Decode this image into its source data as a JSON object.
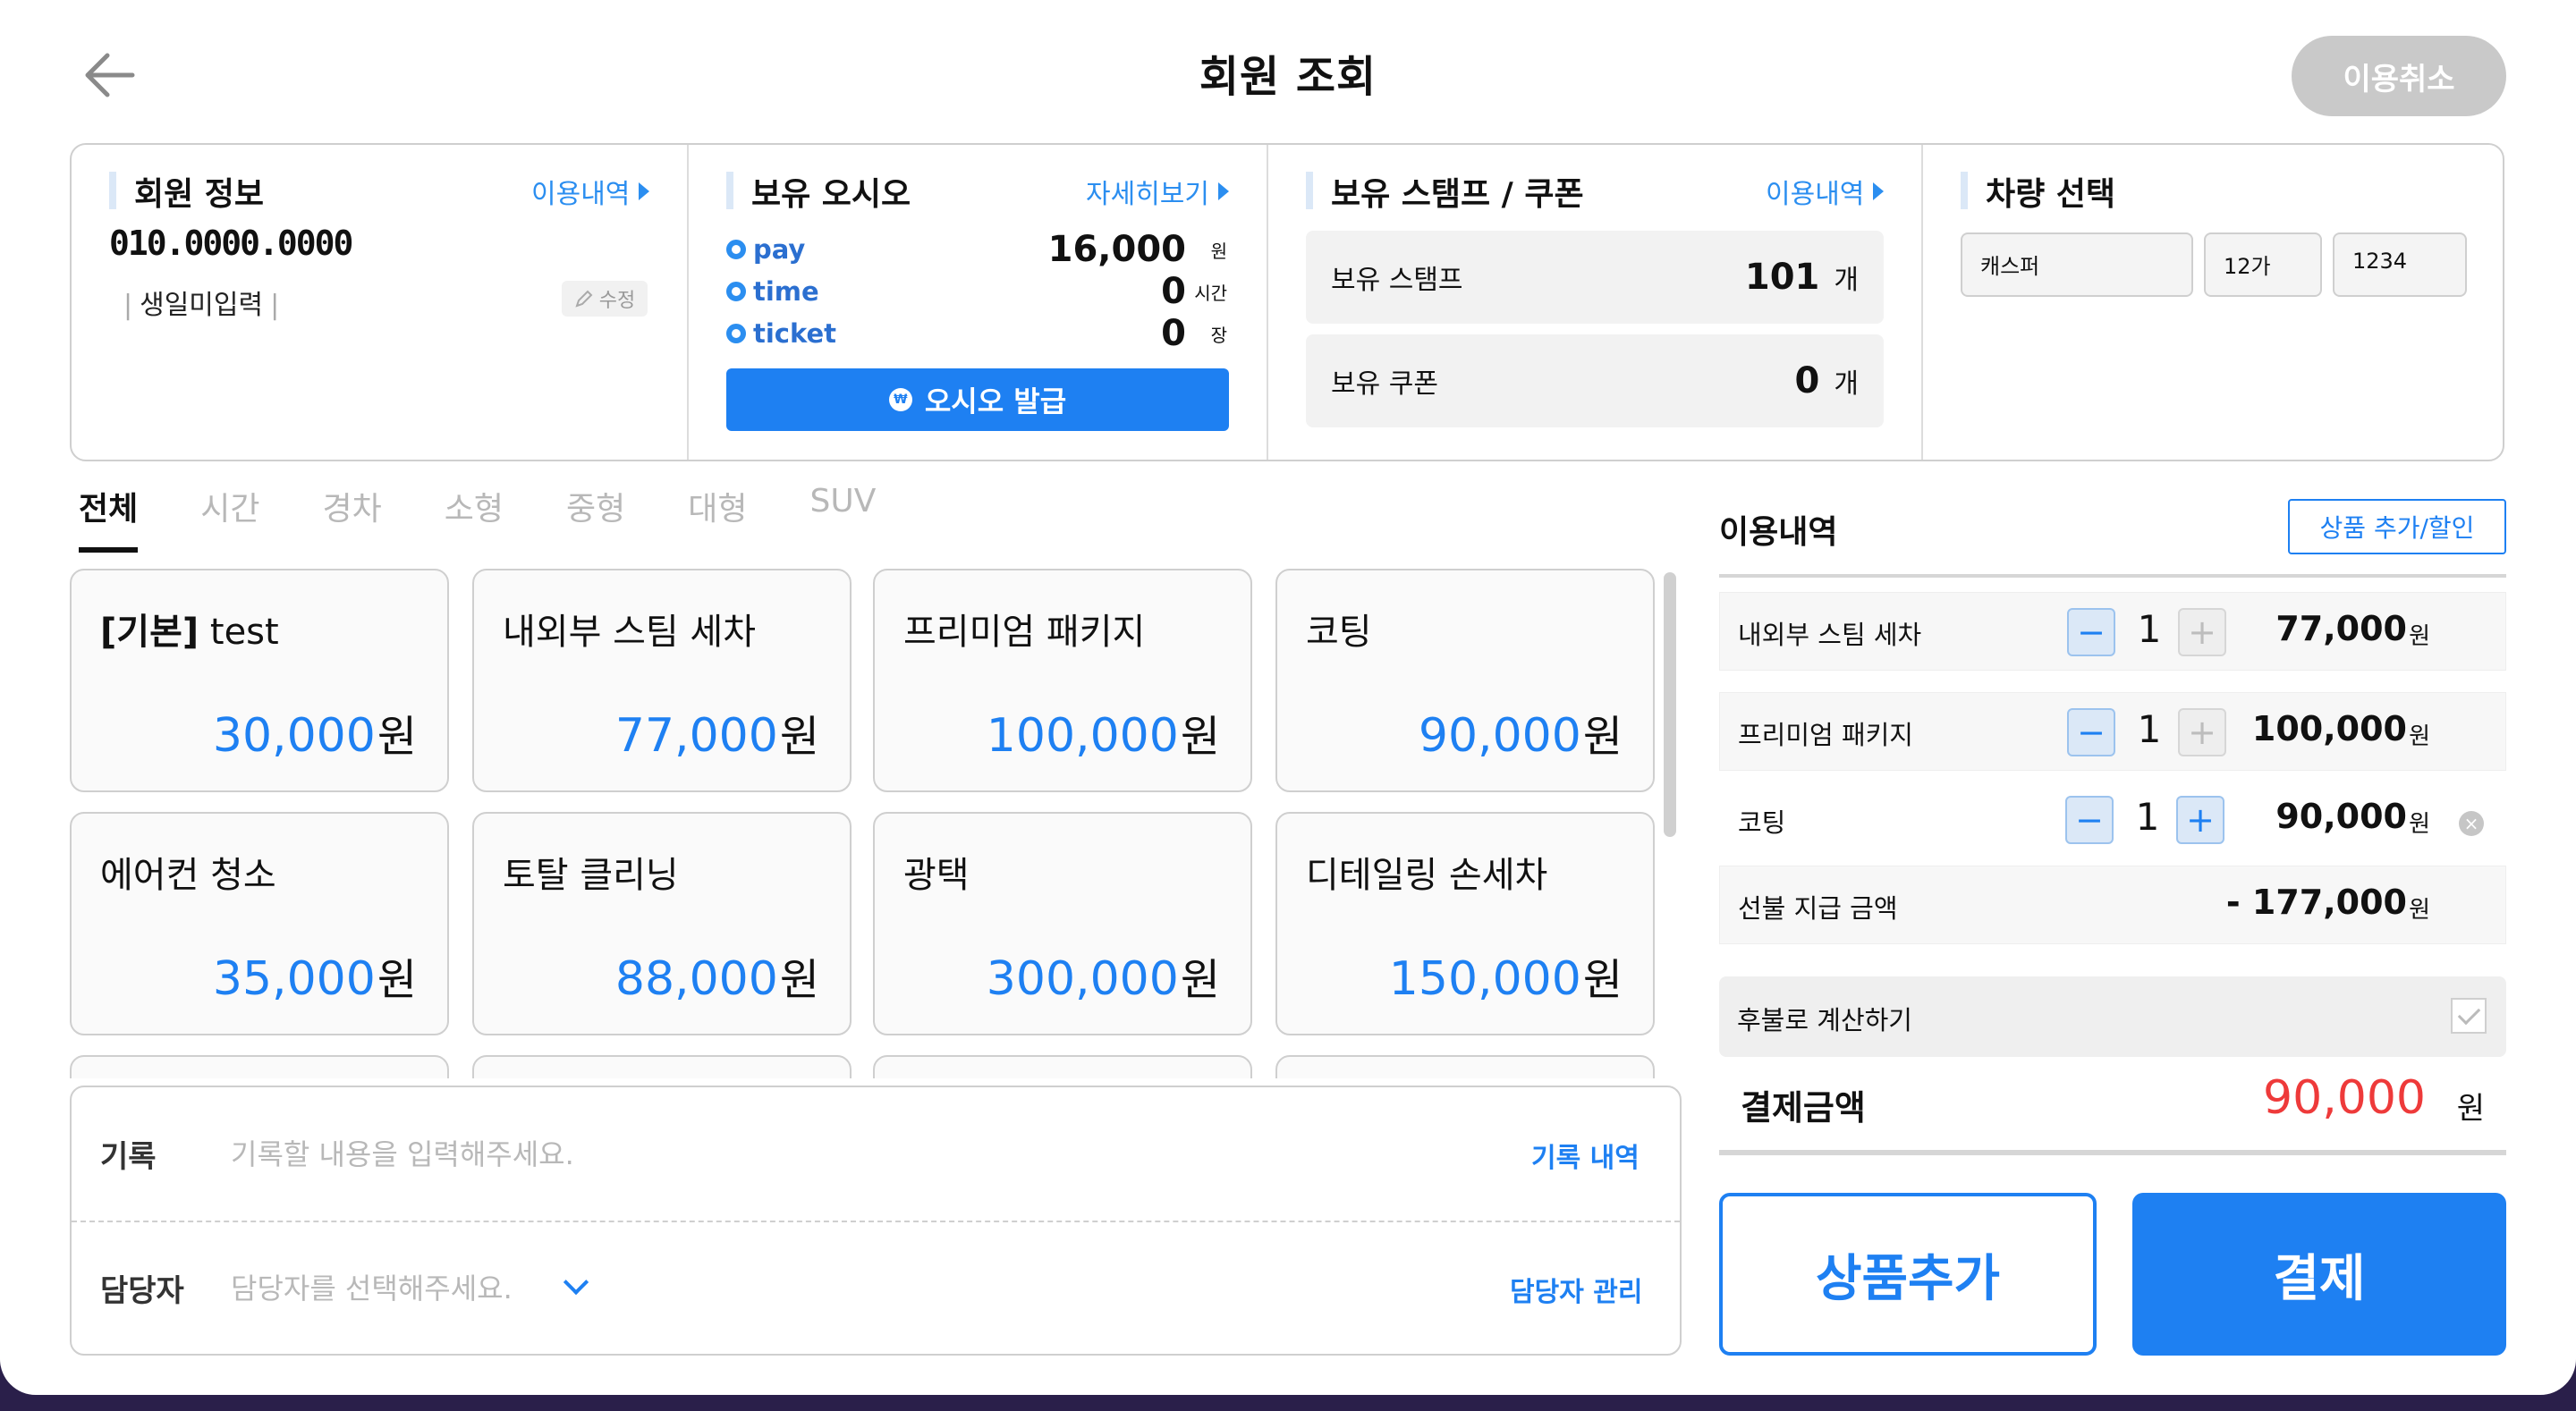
{
  "header": {
    "title": "회원 조회",
    "cancel_label": "이용취소"
  },
  "member": {
    "section_title": "회원 정보",
    "link": "이용내역",
    "phone": "010.0000.0000",
    "birthday": "생일미입력",
    "edit_label": "수정"
  },
  "osio": {
    "section_title": "보유 오시오",
    "link": "자세히보기",
    "rows": [
      {
        "label": "pay",
        "value": "16,000",
        "unit": "원"
      },
      {
        "label": "time",
        "value": "0",
        "unit": "시간"
      },
      {
        "label": "ticket",
        "value": "0",
        "unit": "장"
      }
    ],
    "issue_label": "오시오 발급",
    "coin_glyph": "₩"
  },
  "stamp": {
    "section_title": "보유 스탬프 / 쿠폰",
    "link": "이용내역",
    "rows": [
      {
        "label": "보유 스탬프",
        "value": "101",
        "unit": "개"
      },
      {
        "label": "보유 쿠폰",
        "value": "0",
        "unit": "개"
      }
    ]
  },
  "vehicle": {
    "section_title": "차량 선택",
    "model": "캐스퍼",
    "plate_prefix": "12가",
    "plate_number": "1234"
  },
  "tabs": [
    "전체",
    "시간",
    "경차",
    "소형",
    "중형",
    "대형",
    "SUV"
  ],
  "active_tab": "전체",
  "products": [
    {
      "prefix": "[기본]",
      "name": " test",
      "price": "30,000",
      "unit": "원"
    },
    {
      "prefix": "",
      "name": "내외부 스팀 세차",
      "price": "77,000",
      "unit": "원"
    },
    {
      "prefix": "",
      "name": "프리미엄 패키지",
      "price": "100,000",
      "unit": "원"
    },
    {
      "prefix": "",
      "name": "코팅",
      "price": "90,000",
      "unit": "원"
    },
    {
      "prefix": "",
      "name": "에어컨 청소",
      "price": "35,000",
      "unit": "원"
    },
    {
      "prefix": "",
      "name": "토탈 클리닝",
      "price": "88,000",
      "unit": "원"
    },
    {
      "prefix": "",
      "name": "광택",
      "price": "300,000",
      "unit": "원"
    },
    {
      "prefix": "",
      "name": "디테일링 손세차",
      "price": "150,000",
      "unit": "원"
    }
  ],
  "memo": {
    "record_label": "기록",
    "record_placeholder": "기록할 내용을 입력해주세요.",
    "record_link": "기록 내역",
    "staff_label": "담당자",
    "staff_placeholder": "담당자를 선택해주세요.",
    "staff_link": "담당자 관리"
  },
  "usage": {
    "title": "이용내역",
    "add_discount_label": "상품 추가/할인",
    "items": [
      {
        "name": "내외부 스팀 세차",
        "qty": "1",
        "price": "77,000",
        "unit": "원"
      },
      {
        "name": "프리미엄 패키지",
        "qty": "1",
        "price": "100,000",
        "unit": "원"
      },
      {
        "name": "코팅",
        "qty": "1",
        "price": "90,000",
        "unit": "원"
      }
    ],
    "prepaid": {
      "label": "선불 지급 금액",
      "value": "- 177,000",
      "unit": "원"
    },
    "deferred_label": "후불로 계산하기",
    "total_label": "결제금액",
    "total_value": "90,000",
    "total_unit": "원"
  },
  "actions": {
    "add_product_label": "상품추가",
    "pay_label": "결제"
  },
  "colors": {
    "accent": "#1e80f2",
    "total": "#ee3a3a",
    "muted": "#c9c9c9"
  },
  "icons": {
    "minus": "−",
    "plus": "+",
    "remove": "×"
  }
}
